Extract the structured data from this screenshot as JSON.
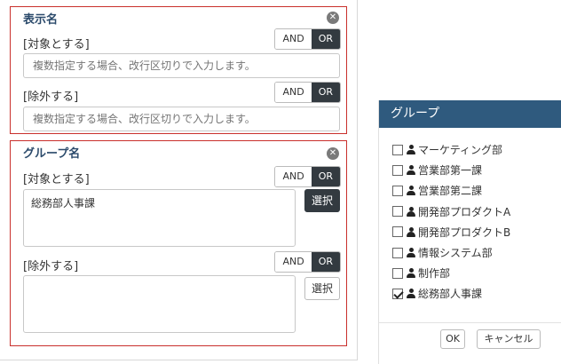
{
  "display_name_section": {
    "title": "表示名",
    "include_label": "[対象とする]",
    "exclude_label": "[除外する]",
    "include_placeholder": "複数指定する場合、改行区切りで入力します。",
    "exclude_placeholder": "複数指定する場合、改行区切りで入力します。",
    "and_label": "AND",
    "or_label": "OR",
    "include_mode": "OR",
    "exclude_mode": "OR"
  },
  "group_name_section": {
    "title": "グループ名",
    "include_label": "[対象とする]",
    "exclude_label": "[除外する]",
    "include_value": "総務部人事課",
    "exclude_value": "",
    "and_label": "AND",
    "or_label": "OR",
    "include_mode": "OR",
    "exclude_mode": "OR",
    "select_label": "選択"
  },
  "group_panel": {
    "title": "グループ",
    "items": [
      {
        "label": "マーケティング部",
        "checked": false
      },
      {
        "label": "営業部第一課",
        "checked": false
      },
      {
        "label": "営業部第二課",
        "checked": false
      },
      {
        "label": "開発部プロダクトA",
        "checked": false
      },
      {
        "label": "開発部プロダクトB",
        "checked": false
      },
      {
        "label": "情報システム部",
        "checked": false
      },
      {
        "label": "制作部",
        "checked": false
      },
      {
        "label": "総務部人事課",
        "checked": true
      }
    ],
    "ok_label": "OK",
    "cancel_label": "キャンセル"
  },
  "icons": {
    "close": "close-circle-icon",
    "user": "user-icon",
    "checkbox": "checkbox-icon"
  },
  "colors": {
    "section_border": "#c9302c",
    "title_text": "#2b4a6b",
    "toggle_active": "#333a40",
    "panel_header": "#2f5a7e"
  }
}
